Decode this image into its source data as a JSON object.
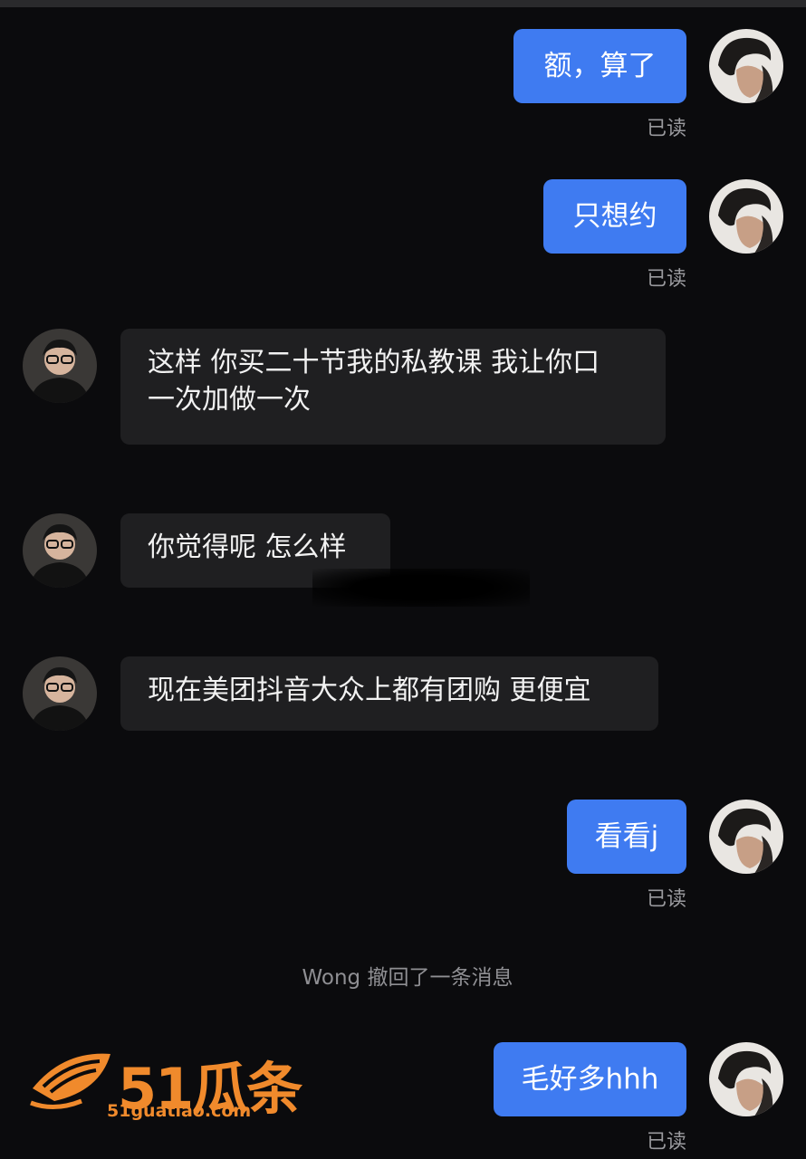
{
  "colors": {
    "background": "#0b0b0d",
    "outgoing_bubble": "#3f7bf1",
    "incoming_bubble": "#1f1f21",
    "read_receipt": "#9a9a9e",
    "watermark": "#f08a2c"
  },
  "messages": {
    "m1": {
      "text": "额，算了",
      "read": "已读"
    },
    "m2": {
      "text": "只想约",
      "read": "已读"
    },
    "m3": {
      "line1": "这样 你买二十节我的私教课 我让你口",
      "line2": "一次加做一次"
    },
    "m4": {
      "text": "你觉得呢 怎么样"
    },
    "m5": {
      "text": "现在美团抖音大众上都有团购 更便宜"
    },
    "m6": {
      "text": "看看j",
      "read": "已读"
    },
    "system": "Wong 撤回了一条消息",
    "m7": {
      "text": "毛好多hhh",
      "read": "已读"
    }
  },
  "watermark": {
    "title": "51瓜条",
    "url": "51guatiao.com"
  },
  "icons": {
    "self_avatar": "person-avatar-icon",
    "peer_avatar": "person-with-glasses-avatar-icon"
  }
}
